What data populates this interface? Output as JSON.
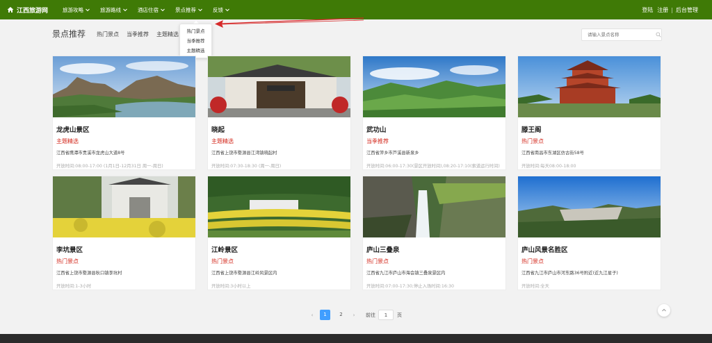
{
  "brand": {
    "name": "江西旅游网"
  },
  "nav": {
    "items": [
      {
        "label": "旅游攻略"
      },
      {
        "label": "旅游路线"
      },
      {
        "label": "酒店住宿"
      },
      {
        "label": "景点推荐"
      },
      {
        "label": "反馈"
      }
    ],
    "login": "登陆",
    "register": "注册",
    "separator": "|",
    "admin": "后台管理"
  },
  "dropdown": {
    "items": [
      "热门景点",
      "当季推荐",
      "主题精选"
    ]
  },
  "section": {
    "title": "景点推荐",
    "tabs": [
      "热门景点",
      "当季推荐",
      "主题精选"
    ],
    "search_placeholder": "请输入景点名称"
  },
  "cards": [
    {
      "title": "龙虎山景区",
      "tag": "主题精选",
      "address": "江西省鹰潭市贵溪市龙虎山大道8号",
      "hours": "开放时间:08:00-17:00 (1月1日-12月31日 周一-周日)",
      "image": "mountain-river"
    },
    {
      "title": "晓起",
      "tag": "主题精选",
      "address": "江西省上饶市婺源县江湾镇晓起村",
      "hours": "开放时间:07:30-18:30 (周一-周日)",
      "image": "ancient-gate"
    },
    {
      "title": "武功山",
      "tag": "当季推荐",
      "address": "江西省萍乡市芦溪县新泉乡",
      "hours": "开放时间:06:00-17:30(景区开放时间),08:20-17:10(索道运行时间)",
      "image": "green-ridge"
    },
    {
      "title": "滕王阁",
      "tag": "热门景点",
      "address": "江西省南昌市东湖区仿古街58号",
      "hours": "开放时间:每天08:00-18:00",
      "image": "pavilion"
    },
    {
      "title": "李坑景区",
      "tag": "热门景点",
      "address": "江西省上饶市婺源县秋口镇李坑村",
      "hours": "开放时间:1-3小时",
      "image": "village-flowers"
    },
    {
      "title": "江岭景区",
      "tag": "热门景点",
      "address": "江西省上饶市婺源县江岭风景区内",
      "hours": "开放时间:3小时以上",
      "image": "terraces"
    },
    {
      "title": "庐山三叠泉",
      "tag": "热门景点",
      "address": "江西省九江市庐山市海会镇三叠泉景区内",
      "hours": "开放时间:07:00-17:30;停止入场时间:16:30",
      "image": "waterfall"
    },
    {
      "title": "庐山风景名胜区",
      "tag": "热门景点",
      "address": "江西省九江市庐山市河东路36号附近(近九江星子)",
      "hours": "开放时间:全天",
      "image": "cliffs"
    }
  ],
  "pagination": {
    "prev": "‹",
    "pages": [
      "1",
      "2"
    ],
    "current": "1",
    "next": "›",
    "goto_label": "前往",
    "goto_value": "1",
    "unit": "页"
  },
  "colors": {
    "nav_bg": "#3f7a06",
    "accent_red": "#d3281c",
    "page_active": "#409eff"
  },
  "icons": {
    "brand": "home-icon",
    "search": "search-icon",
    "back_to_top": "chevron-up-icon"
  }
}
